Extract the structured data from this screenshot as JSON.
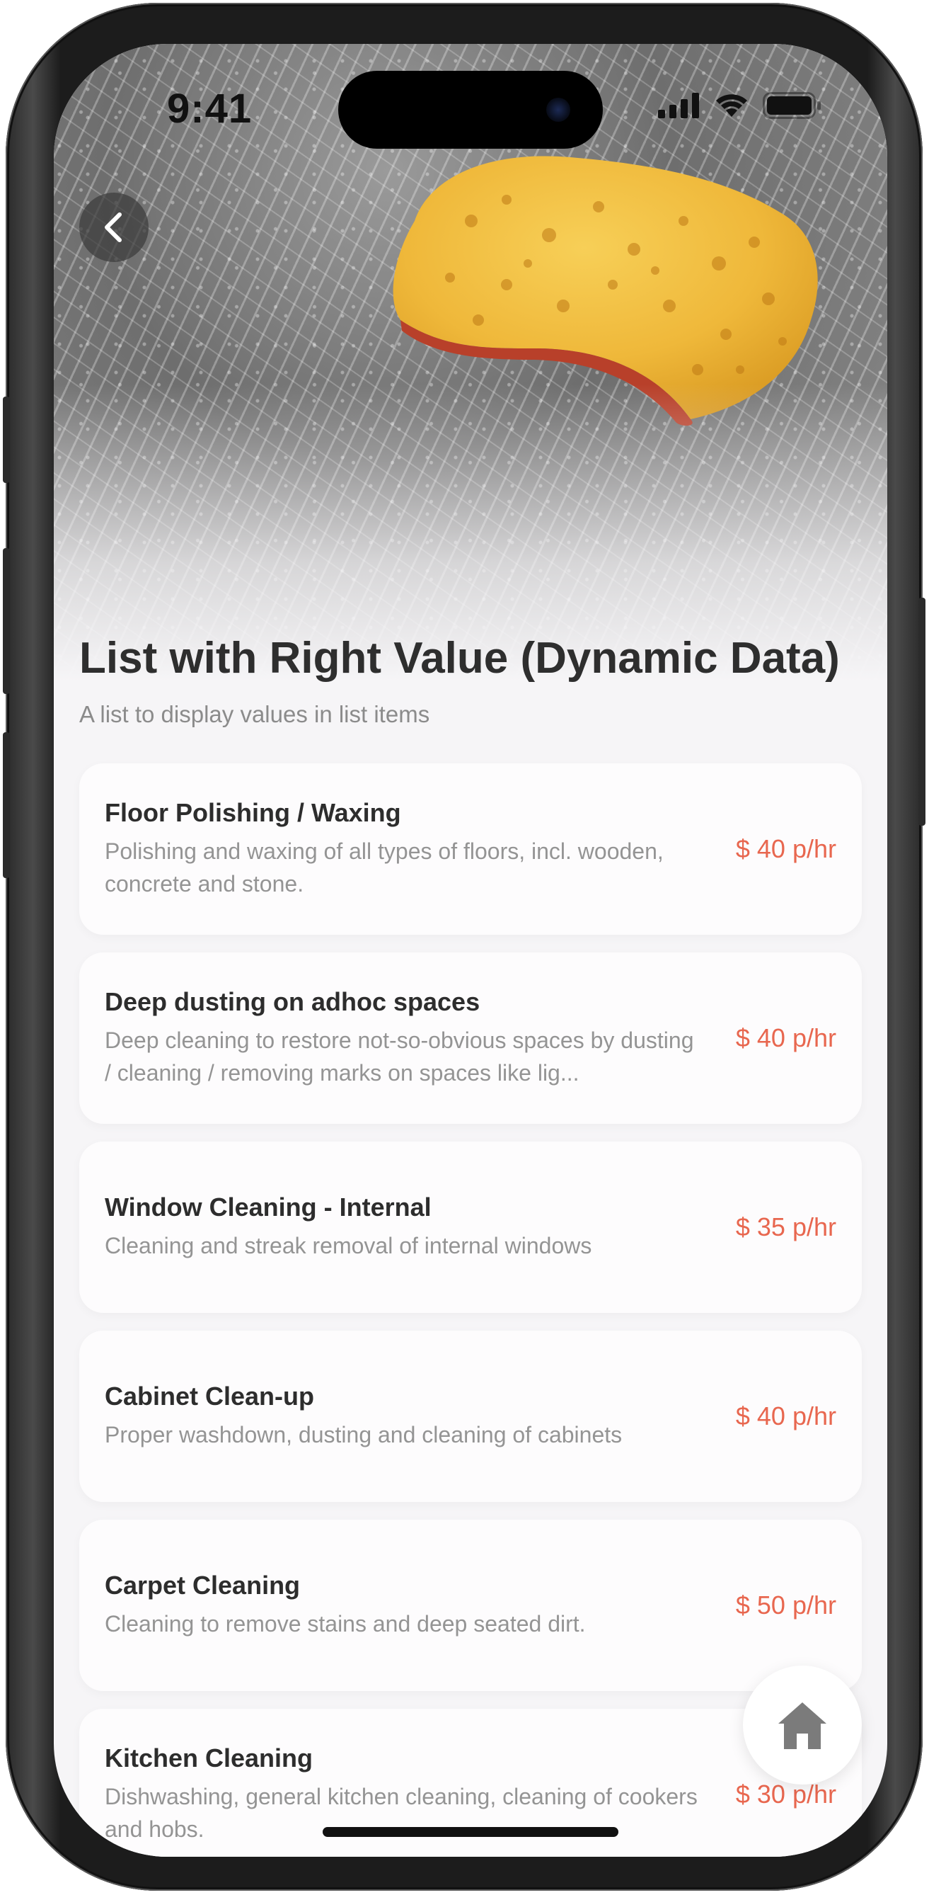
{
  "status_bar": {
    "time": "9:41",
    "icons": [
      "cellular-signal-icon",
      "wifi-icon",
      "battery-icon"
    ]
  },
  "hero": {
    "image": "sponge-on-soapy-surface-photo",
    "back_icon": "chevron-left-icon"
  },
  "page": {
    "title": "List with Right Value (Dynamic Data)",
    "subtitle": "A list to display values in list items"
  },
  "list": {
    "items": [
      {
        "title": "Floor Polishing / Waxing",
        "description": "Polishing and waxing of all types of floors, incl. wooden, concrete and stone.",
        "price": "$ 40 p/hr"
      },
      {
        "title": "Deep dusting on adhoc spaces",
        "description": "Deep cleaning to restore not-so-obvious spaces by dusting / cleaning / removing marks on spaces like lig...",
        "price": "$ 40 p/hr"
      },
      {
        "title": "Window Cleaning - Internal",
        "description": "Cleaning and streak removal of internal windows",
        "price": "$ 35 p/hr"
      },
      {
        "title": "Cabinet Clean-up",
        "description": "Proper washdown, dusting and cleaning of cabinets",
        "price": "$ 40 p/hr"
      },
      {
        "title": "Carpet Cleaning",
        "description": "Cleaning to remove stains and deep seated dirt.",
        "price": "$ 50 p/hr"
      },
      {
        "title": "Kitchen Cleaning",
        "description": "Dishwashing, general kitchen cleaning, cleaning of cookers and hobs.",
        "price": "$ 30 p/hr"
      }
    ]
  },
  "fab": {
    "icon": "home-icon"
  },
  "colors": {
    "accent_price": "#e8674f",
    "title_text": "#2e2e2e",
    "secondary_text": "#949494",
    "background": "#f6f5f7",
    "card": "#fdfcfd"
  }
}
